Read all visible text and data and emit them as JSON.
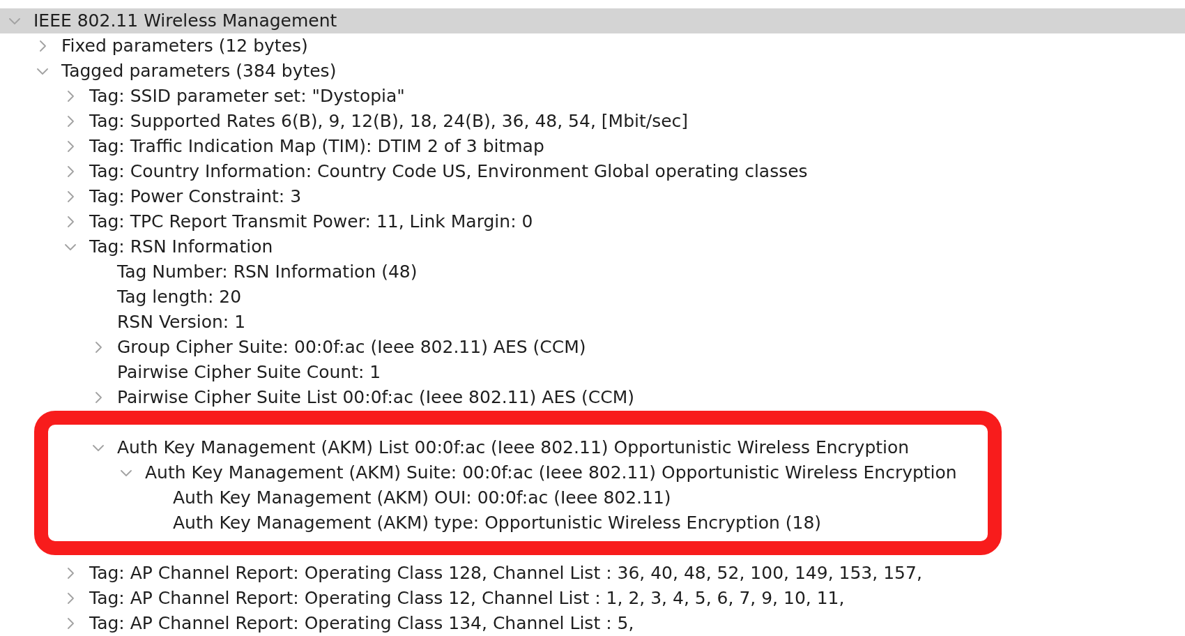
{
  "tree": [
    {
      "label": "IEEE 802.11 Wireless Management",
      "expanded": true,
      "selected": true,
      "highlighted": false,
      "children": [
        {
          "label": "Fixed parameters (12 bytes)",
          "expanded": false,
          "selected": false,
          "highlighted": false
        },
        {
          "label": "Tagged parameters (384 bytes)",
          "expanded": true,
          "selected": false,
          "highlighted": false,
          "children": [
            {
              "label": "Tag: SSID parameter set: \"Dystopia\"",
              "expanded": false,
              "selected": false,
              "highlighted": false
            },
            {
              "label": "Tag: Supported Rates 6(B), 9, 12(B), 18, 24(B), 36, 48, 54, [Mbit/sec]",
              "expanded": false,
              "selected": false,
              "highlighted": false
            },
            {
              "label": "Tag: Traffic Indication Map (TIM): DTIM 2 of 3 bitmap",
              "expanded": false,
              "selected": false,
              "highlighted": false
            },
            {
              "label": "Tag: Country Information: Country Code US, Environment Global operating classes",
              "expanded": false,
              "selected": false,
              "highlighted": false
            },
            {
              "label": "Tag: Power Constraint: 3",
              "expanded": false,
              "selected": false,
              "highlighted": false
            },
            {
              "label": "Tag: TPC Report Transmit Power: 11, Link Margin: 0",
              "expanded": false,
              "selected": false,
              "highlighted": false
            },
            {
              "label": "Tag: RSN Information",
              "expanded": true,
              "selected": false,
              "highlighted": false,
              "children": [
                {
                  "label": "Tag Number: RSN Information (48)",
                  "selected": false,
                  "highlighted": false
                },
                {
                  "label": "Tag length: 20",
                  "selected": false,
                  "highlighted": false
                },
                {
                  "label": "RSN Version: 1",
                  "selected": false,
                  "highlighted": false
                },
                {
                  "label": "Group Cipher Suite: 00:0f:ac (Ieee 802.11) AES (CCM)",
                  "expanded": false,
                  "selected": false,
                  "highlighted": false
                },
                {
                  "label": "Pairwise Cipher Suite Count: 1",
                  "selected": false,
                  "highlighted": false
                },
                {
                  "label": "Pairwise Cipher Suite List 00:0f:ac (Ieee 802.11) AES (CCM)",
                  "expanded": false,
                  "selected": false,
                  "highlighted": false
                },
                {
                  "label": "Auth Key Management (AKM) List 00:0f:ac (Ieee 802.11) Opportunistic Wireless Encryption",
                  "expanded": true,
                  "selected": false,
                  "highlighted": true,
                  "children": [
                    {
                      "label": "Auth Key Management (AKM) Suite: 00:0f:ac (Ieee 802.11) Opportunistic Wireless Encryption",
                      "expanded": true,
                      "selected": false,
                      "highlighted": false,
                      "children": [
                        {
                          "label": "Auth Key Management (AKM) OUI: 00:0f:ac (Ieee 802.11)",
                          "selected": false,
                          "highlighted": false
                        },
                        {
                          "label": "Auth Key Management (AKM) type: Opportunistic Wireless Encryption (18)",
                          "selected": false,
                          "highlighted": false
                        }
                      ]
                    }
                  ]
                }
              ]
            },
            {
              "label": "Tag: AP Channel Report: Operating Class 128, Channel List : 36, 40, 48, 52, 100, 149, 153, 157,",
              "expanded": false,
              "selected": false,
              "highlighted": false
            },
            {
              "label": "Tag: AP Channel Report: Operating Class 12, Channel List : 1, 2, 3, 4, 5, 6, 7, 9, 10, 11,",
              "expanded": false,
              "selected": false,
              "highlighted": false
            },
            {
              "label": "Tag: AP Channel Report: Operating Class 134, Channel List : 5,",
              "expanded": false,
              "selected": false,
              "highlighted": false
            }
          ]
        }
      ]
    }
  ]
}
